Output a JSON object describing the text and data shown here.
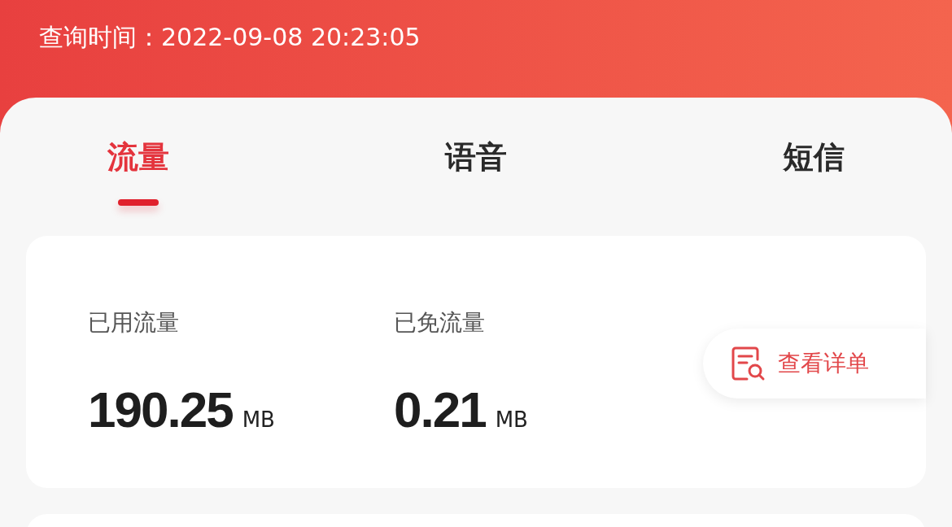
{
  "header": {
    "query_time": "查询时间：2022-09-08 20:23:05"
  },
  "tabs": [
    {
      "label": "流量",
      "selected": true
    },
    {
      "label": "语音",
      "selected": false
    },
    {
      "label": "短信",
      "selected": false
    }
  ],
  "usage": {
    "stats": [
      {
        "label": "已用流量",
        "value": "190.25",
        "unit": "MB"
      },
      {
        "label": "已免流量",
        "value": "0.21",
        "unit": "MB"
      }
    ],
    "detail_button": "查看详单"
  }
}
